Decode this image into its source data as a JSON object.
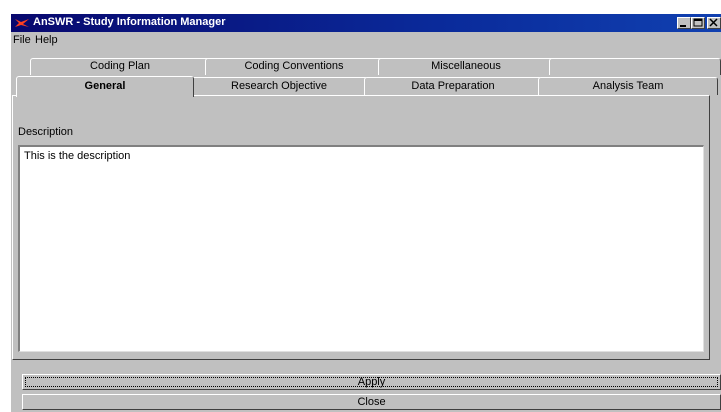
{
  "window": {
    "title": "AnSWR - Study Information Manager"
  },
  "menu": [
    {
      "label": "File"
    },
    {
      "label": "Help"
    }
  ],
  "tabs_back": [
    {
      "label": "Coding Plan"
    },
    {
      "label": "Coding Conventions"
    },
    {
      "label": "Miscellaneous"
    },
    {
      "label": ""
    }
  ],
  "tabs_front": [
    {
      "label": "General",
      "active": true
    },
    {
      "label": "Research Objective"
    },
    {
      "label": "Data Preparation"
    },
    {
      "label": "Analysis Team"
    }
  ],
  "general": {
    "description_label": "Description",
    "description_value": "This is the description"
  },
  "buttons": {
    "apply_label": "Apply",
    "close_label": "Close"
  },
  "colors": {
    "titlebar": "#08086e",
    "face": "#c0c0c0"
  },
  "icons": [
    "app-icon",
    "minimize-icon",
    "maximize-icon",
    "close-icon"
  ]
}
